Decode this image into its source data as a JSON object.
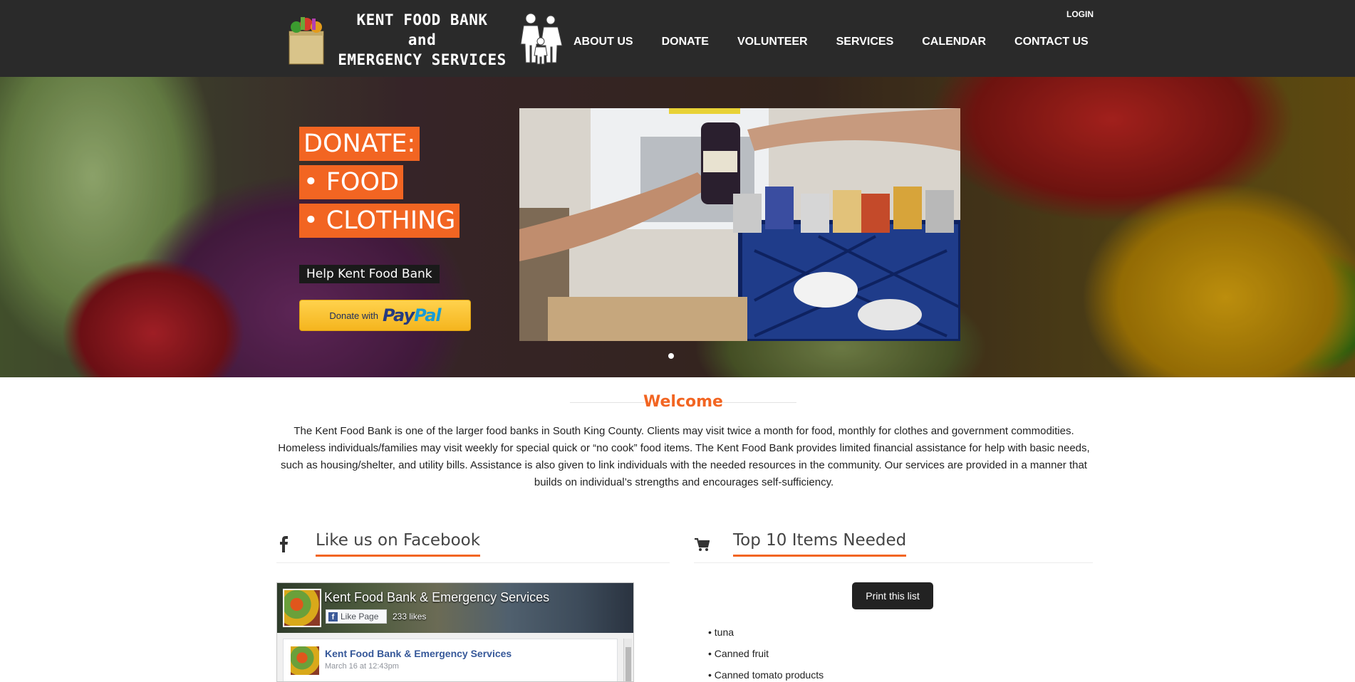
{
  "header": {
    "logo_lines": [
      "KENT FOOD BANK",
      "and",
      "EMERGENCY SERVICES"
    ],
    "login_label": "LOGIN",
    "nav": [
      "ABOUT US",
      "DONATE",
      "VOLUNTEER",
      "SERVICES",
      "CALENDAR",
      "CONTACT US"
    ]
  },
  "hero": {
    "promo_lines": [
      "DONATE:",
      "• FOOD",
      "• CLOTHING"
    ],
    "help_label": "Help Kent Food Bank",
    "paypal": {
      "prefix": "Donate with",
      "brand_part1": "Pay",
      "brand_part2": "Pal"
    },
    "slides_total": 1,
    "active_slide": 1
  },
  "welcome": {
    "title": "Welcome",
    "text": "The Kent Food Bank is one of the larger food banks in South King County. Clients may visit twice a month for food, monthly for clothes and government commodities. Homeless individuals/families may visit weekly for special quick or “no cook” food items. The Kent Food Bank provides limited financial assistance for help with basic needs, such as housing/shelter, and utility bills. Assistance is also given to link individuals with the needed resources in the community. Our services are provided in a manner that builds on individual’s strengths and encourages self-sufficiency."
  },
  "facebook": {
    "heading": "Like us on Facebook",
    "page_name": "Kent Food Bank & Emergency Services",
    "like_label": "Like Page",
    "likes": "233 likes",
    "post_author": "Kent Food Bank & Emergency Services",
    "post_date": "March 16 at 12:43pm"
  },
  "needed": {
    "heading": "Top 10 Items Needed",
    "print_label": "Print this list",
    "items": [
      "• tuna",
      "• Canned fruit",
      "• Canned tomato products"
    ]
  },
  "colors": {
    "accent": "#f26522",
    "header_bg": "#2a2a2a",
    "paypal_gold": "#ffc439"
  },
  "icons": {
    "facebook": "facebook-icon",
    "cart": "shopping-cart-icon"
  }
}
